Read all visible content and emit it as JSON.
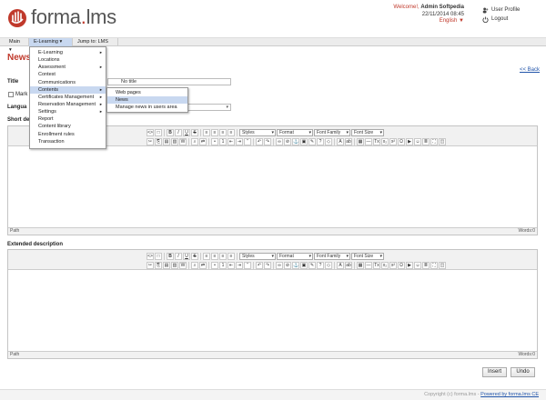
{
  "header": {
    "logo_text": "forma",
    "logo_dot": ".",
    "logo_suffix": "lms",
    "welcome_prefix": "Welcome!,",
    "user_name": "Admin Softpedia",
    "datetime": "22/11/2014 08:45",
    "language": "English",
    "user_profile_label": "User Profile",
    "logout_label": "Logout"
  },
  "nav": {
    "items": [
      {
        "label": "Main"
      },
      {
        "label": "E-Learning"
      },
      {
        "label": "Jump to: LMS"
      }
    ]
  },
  "menu": {
    "items": [
      {
        "label": "E-Learning",
        "sub": true
      },
      {
        "label": "Locations",
        "sub": false
      },
      {
        "label": "Assessment",
        "sub": true
      },
      {
        "label": "Contest",
        "sub": false
      },
      {
        "label": "Communications",
        "sub": false
      },
      {
        "label": "Contents",
        "sub": true
      },
      {
        "label": "Certificates Management",
        "sub": true
      },
      {
        "label": "Reservation Management",
        "sub": true
      },
      {
        "label": "Settings",
        "sub": true
      },
      {
        "label": "Report",
        "sub": false
      },
      {
        "label": "Content library",
        "sub": false
      },
      {
        "label": "Enrollment rules",
        "sub": false
      },
      {
        "label": "Transaction",
        "sub": false
      }
    ],
    "highlighted_index": 5
  },
  "submenu": {
    "items": [
      {
        "label": "Web pages"
      },
      {
        "label": "News"
      },
      {
        "label": "Manage news in users area"
      }
    ],
    "highlighted_index": 1
  },
  "page": {
    "title": "News",
    "back_link": "<< Back"
  },
  "form": {
    "title_label": "Title",
    "title_value": "No title",
    "mark_label": "Mark",
    "language_label": "Langua",
    "short_label": "Short de",
    "extended_label": "Extended description"
  },
  "editor": {
    "styles": "Styles",
    "format": "Format",
    "font_family": "Font Family",
    "font_size": "Font Size",
    "path_label": "Path",
    "words_label": "Words:0"
  },
  "buttons": {
    "insert": "Insert",
    "undo": "Undo"
  },
  "footer": {
    "copyright": "Copyright (c) forma.lms - ",
    "powered": "Powered by forma.lms CE"
  },
  "colors": {
    "brand_red": "#c0392b",
    "link_blue": "#2255aa",
    "menu_highlight": "#c8d8f0"
  }
}
